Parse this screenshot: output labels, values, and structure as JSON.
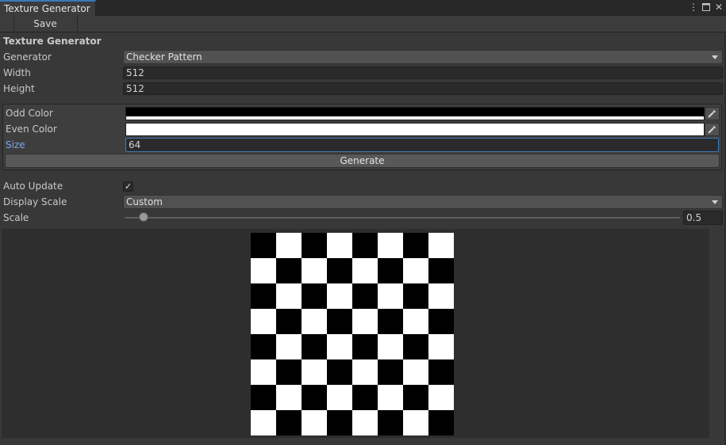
{
  "window": {
    "tab_title": "Texture Generator",
    "tab_icons": [
      "more-icon",
      "maximize-icon",
      "close-icon"
    ]
  },
  "toolbar": {
    "save_label": "Save"
  },
  "section_title": "Texture Generator",
  "fields": {
    "generator_label": "Generator",
    "generator_value": "Checker Pattern",
    "width_label": "Width",
    "width_value": "512",
    "height_label": "Height",
    "height_value": "512"
  },
  "pattern": {
    "odd_color_label": "Odd Color",
    "odd_color": "#000000",
    "even_color_label": "Even Color",
    "even_color": "#ffffff",
    "size_label": "Size",
    "size_value": "64",
    "generate_label": "Generate"
  },
  "display": {
    "auto_update_label": "Auto Update",
    "auto_update_checked": true,
    "checkmark": "✓",
    "display_scale_label": "Display Scale",
    "display_scale_value": "Custom",
    "scale_label": "Scale",
    "scale_value": "0.5",
    "scale_fraction": 0.02
  },
  "preview": {
    "grid_cells": 8
  },
  "colors": {
    "accent": "#3a79bb",
    "size_label_color": "#7ea9e8"
  }
}
